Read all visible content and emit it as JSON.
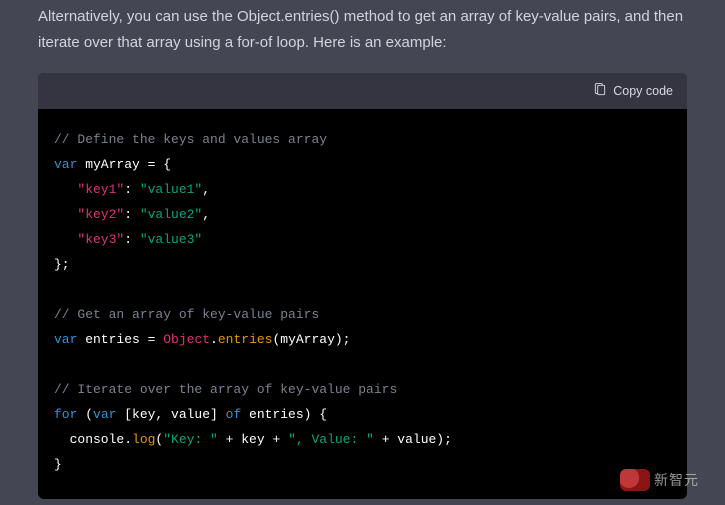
{
  "prose": {
    "paragraph": "Alternatively, you can use the Object.entries() method to get an array of key-value pairs, and then iterate over that array using a for-of loop. Here is an example:"
  },
  "toolbar": {
    "copy_label": "Copy code"
  },
  "code": {
    "c1": "// Define the keys and values array",
    "kw_var1": "var",
    "var_myArray": " myArray = {",
    "k1": "\"key1\"",
    "colon1": ": ",
    "v1": "\"value1\"",
    "comma1": ",",
    "k2": "\"key2\"",
    "colon2": ": ",
    "v2": "\"value2\"",
    "comma2": ",",
    "k3": "\"key3\"",
    "colon3": ": ",
    "v3": "\"value3\"",
    "close_obj": "};",
    "c2": "// Get an array of key-value pairs",
    "kw_var2": "var",
    "var_entries": " entries = ",
    "obj_builtin": "Object",
    "dot1": ".",
    "entries_m": "entries",
    "call_myArray": "(myArray);",
    "c3": "// Iterate over the array of key-value pairs",
    "kw_for": "for",
    "for_open": " (",
    "kw_var3": "var",
    "destruct": " [key, value] ",
    "kw_of": "of",
    "for_rest": " entries) {",
    "indent_console": "  console.",
    "log_m": "log",
    "log_open": "(",
    "str_key": "\"Key: \"",
    "plus1": " + key + ",
    "str_value": "\", Value: \"",
    "plus2": " + value);",
    "close_for": "}"
  },
  "watermark": {
    "text": "新智元"
  }
}
